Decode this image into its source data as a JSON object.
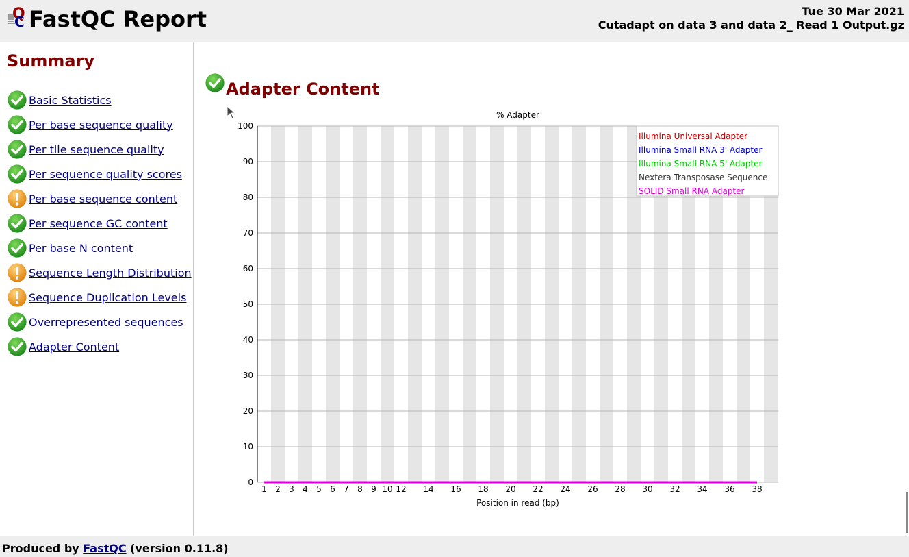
{
  "header": {
    "title": "FastQC Report",
    "date": "Tue 30 Mar 2021",
    "filename": "Cutadapt on data 3 and data 2_ Read 1 Output.gz"
  },
  "sidebar": {
    "title": "Summary",
    "items": [
      {
        "label": "Basic Statistics",
        "status": "pass"
      },
      {
        "label": "Per base sequence quality",
        "status": "pass"
      },
      {
        "label": "Per tile sequence quality",
        "status": "pass"
      },
      {
        "label": "Per sequence quality scores",
        "status": "pass"
      },
      {
        "label": "Per base sequence content",
        "status": "warn"
      },
      {
        "label": "Per sequence GC content",
        "status": "pass"
      },
      {
        "label": "Per base N content",
        "status": "pass"
      },
      {
        "label": "Sequence Length Distribution",
        "status": "warn"
      },
      {
        "label": "Sequence Duplication Levels",
        "status": "warn"
      },
      {
        "label": "Overrepresented sequences",
        "status": "pass"
      },
      {
        "label": "Adapter Content",
        "status": "pass"
      }
    ]
  },
  "module": {
    "title": "Adapter Content",
    "status": "pass"
  },
  "footer": {
    "prefix": "Produced by",
    "link": "FastQC",
    "suffix": "(version 0.11.8)"
  },
  "colors": {
    "heading": "#800000",
    "link": "#000080",
    "pass": "#2ea82e",
    "warn": "#f59a12"
  },
  "chart_data": {
    "type": "line",
    "title": "% Adapter",
    "xlabel": "Position in read (bp)",
    "ylabel": "",
    "ylim": [
      0,
      100
    ],
    "yticks": [
      0,
      10,
      20,
      30,
      40,
      50,
      60,
      70,
      80,
      90,
      100
    ],
    "grid": true,
    "legend_position": "top-right",
    "x": [
      "1",
      "2",
      "3",
      "4",
      "5",
      "6",
      "7",
      "8",
      "9",
      "10",
      "12",
      "14",
      "16",
      "18",
      "20",
      "22",
      "24",
      "26",
      "28",
      "30",
      "32",
      "34",
      "36",
      "38"
    ],
    "x_bin_widths": [
      1,
      1,
      1,
      1,
      1,
      1,
      1,
      1,
      1,
      1,
      2,
      2,
      2,
      2,
      2,
      2,
      2,
      2,
      2,
      2,
      2,
      2,
      2,
      2
    ],
    "series": [
      {
        "name": "Illumina Universal Adapter",
        "color": "#cc0000",
        "values": [
          0,
          0,
          0,
          0,
          0,
          0,
          0,
          0,
          0,
          0,
          0,
          0,
          0,
          0,
          0,
          0,
          0,
          0,
          0,
          0,
          0,
          0,
          0,
          0
        ]
      },
      {
        "name": "Illumina Small RNA 3' Adapter",
        "color": "#0000cc",
        "values": [
          0,
          0,
          0,
          0,
          0,
          0,
          0,
          0,
          0,
          0,
          0,
          0,
          0,
          0,
          0,
          0,
          0,
          0,
          0,
          0,
          0,
          0,
          0,
          0
        ]
      },
      {
        "name": "Illumina Small RNA 5' Adapter",
        "color": "#00cc00",
        "values": [
          0,
          0,
          0,
          0,
          0,
          0,
          0,
          0,
          0,
          0,
          0,
          0,
          0,
          0,
          0,
          0,
          0,
          0,
          0,
          0,
          0,
          0,
          0,
          0
        ]
      },
      {
        "name": "Nextera Transposase Sequence",
        "color": "#333333",
        "values": [
          0,
          0,
          0,
          0,
          0,
          0,
          0,
          0,
          0,
          0,
          0,
          0,
          0,
          0,
          0,
          0,
          0,
          0,
          0,
          0,
          0,
          0,
          0,
          0
        ]
      },
      {
        "name": "SOLID Small RNA Adapter",
        "color": "#dd00dd",
        "values": [
          0,
          0,
          0,
          0,
          0,
          0,
          0,
          0,
          0,
          0,
          0,
          0,
          0,
          0,
          0,
          0,
          0,
          0,
          0,
          0,
          0,
          0,
          0,
          0
        ]
      }
    ]
  }
}
